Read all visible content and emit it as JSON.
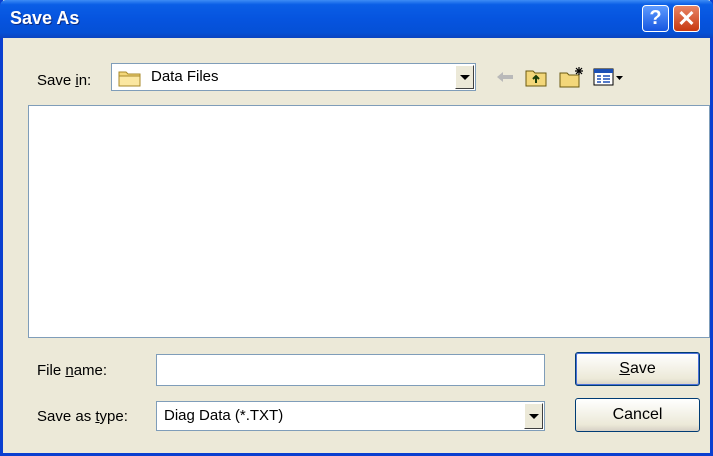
{
  "window": {
    "title": "Save As"
  },
  "titlebar": {
    "help_glyph": "?",
    "close_glyph": "✕"
  },
  "save_in": {
    "label_pre": "Save ",
    "label_mnemonic": "i",
    "label_post": "n:",
    "value": "Data Files",
    "icon": "folder-icon"
  },
  "toolbar": {
    "icons": [
      "back-arrow-icon",
      "up-folder-icon",
      "new-folder-icon",
      "view-menu-icon"
    ]
  },
  "file_name": {
    "label_pre": "File ",
    "label_mnemonic": "n",
    "label_post": "ame:",
    "value": ""
  },
  "save_as_type": {
    "label_pre": "Save as ",
    "label_mnemonic": "t",
    "label_post": "ype:",
    "value": "Diag Data (*.TXT)"
  },
  "buttons": {
    "save_mnemonic": "S",
    "save_rest": "ave",
    "cancel": "Cancel"
  },
  "colors": {
    "titlebar": "#0654df",
    "dialog_bg": "#ece9d8",
    "close_button": "#c73810",
    "help_button": "#1656e0"
  }
}
